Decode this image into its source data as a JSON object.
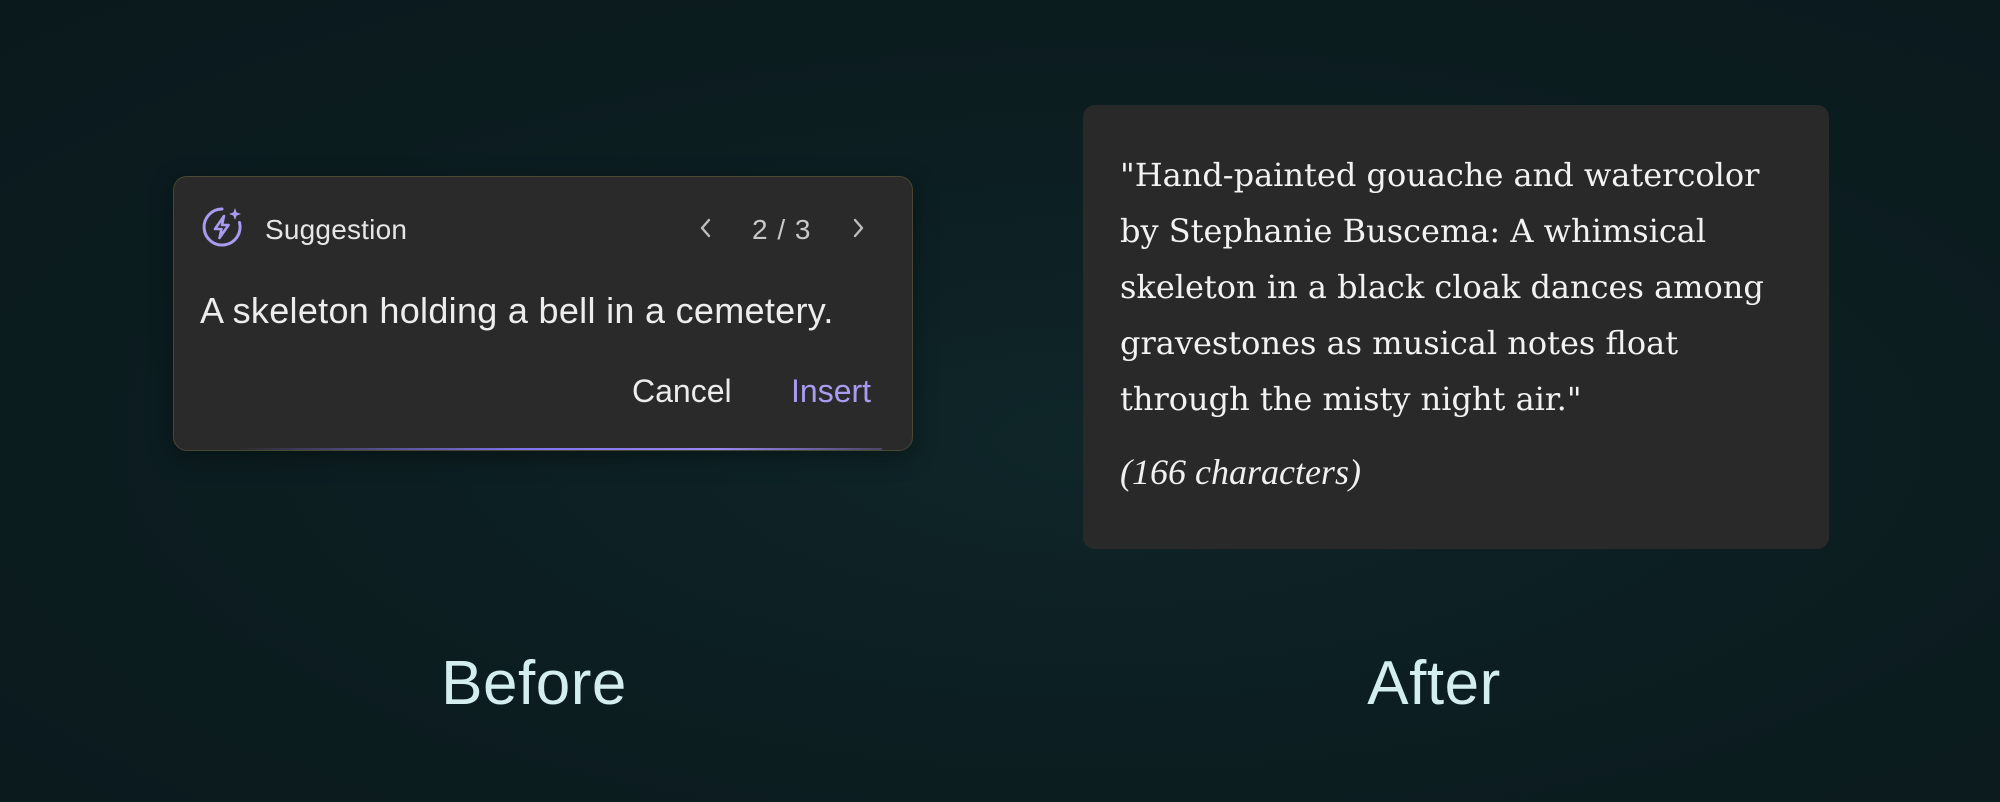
{
  "suggestion": {
    "title": "Suggestion",
    "page_indicator": "2 / 3",
    "text": "A skeleton holding a bell in a cemetery.",
    "cancel_label": "Cancel",
    "insert_label": "Insert"
  },
  "result": {
    "text": "\"Hand-painted gouache and watercolor by Stephanie Buscema: A whimsical skeleton in a black cloak dances among gravestones as musical notes float through the misty night air.\"",
    "char_count": "(166 characters)"
  },
  "captions": {
    "before": "Before",
    "after": "After"
  },
  "icons": {
    "suggestion": "lightning-bolt-circle-icon",
    "prev": "chevron-left-icon",
    "next": "chevron-right-icon"
  },
  "colors": {
    "accent": "#a99cf0",
    "card_background": "#2a2a2b",
    "page_background": "#0c1e21",
    "caption": "#d4eef0"
  }
}
